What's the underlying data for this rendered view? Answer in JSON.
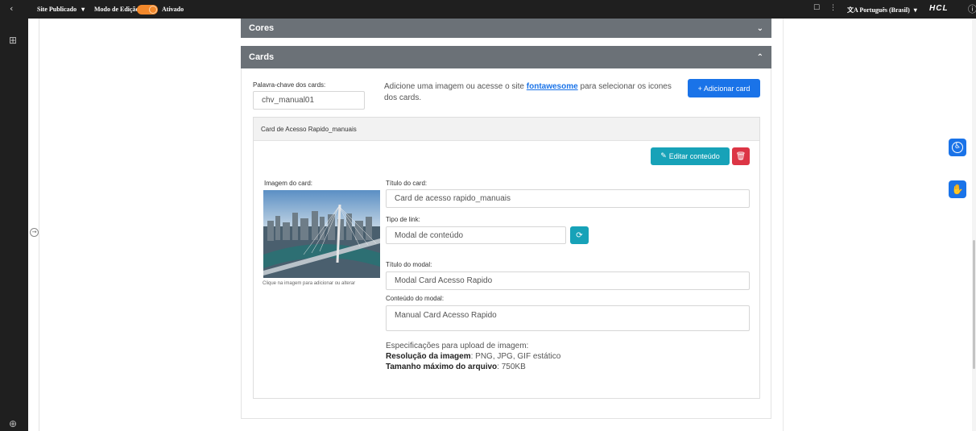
{
  "topbar": {
    "back_icon": "chevron-left-icon",
    "site_label": "Site Publicado",
    "site_caret": "▾",
    "edit_mode_label": "Modo de Edição:",
    "edit_mode_state": "Ativado",
    "toggle_color": "#f2882b",
    "language_label": "Português (Brasil)",
    "language_caret": "▾",
    "brand": "HCL"
  },
  "sections": {
    "cores": {
      "title": "Cores",
      "icon": "chevron-down-icon"
    },
    "cards": {
      "title": "Cards",
      "icon": "chevron-up-icon"
    }
  },
  "cards_section": {
    "keyword_label": "Palavra-chave dos cards:",
    "keyword_value": "chv_manual01",
    "desc_before": "Adicione uma imagem ou acesse o site ",
    "desc_link": "fontawesome",
    "desc_after": " para selecionar os icones dos cards.",
    "add_button": "+ Adicionar card",
    "accent_color": "#1a73e8"
  },
  "card": {
    "header": "Card de Acesso Rapido_manuais",
    "edit_button": "Editar conteúdo",
    "image_label": "Imagem do card:",
    "image_caption": "Clique na imagem para adicionar ou alterar",
    "title_label": "Título do card:",
    "title_value": "Card de acesso rapido_manuais",
    "link_type_label": "Tipo de link:",
    "link_type_value": "Modal de conteúdo",
    "modal_title_label": "Título do modal:",
    "modal_title_value": "Modal Card Acesso Rapido",
    "modal_content_label": "Conteúdo do modal:",
    "modal_content_value": "Manual Card Acesso Rapido",
    "specs_heading": "Especificações para upload de imagem:",
    "resolution_label": "Resolução da imagem",
    "resolution_value": ": PNG, JPG, GIF estático",
    "max_size_label": "Tamanho máximo do arquivo",
    "max_size_value": ": 750KB"
  },
  "accessibility": {
    "a11y_icon": "accessibility-icon",
    "libras_icon": "sign-language-icon",
    "color": "#1a73e8"
  }
}
